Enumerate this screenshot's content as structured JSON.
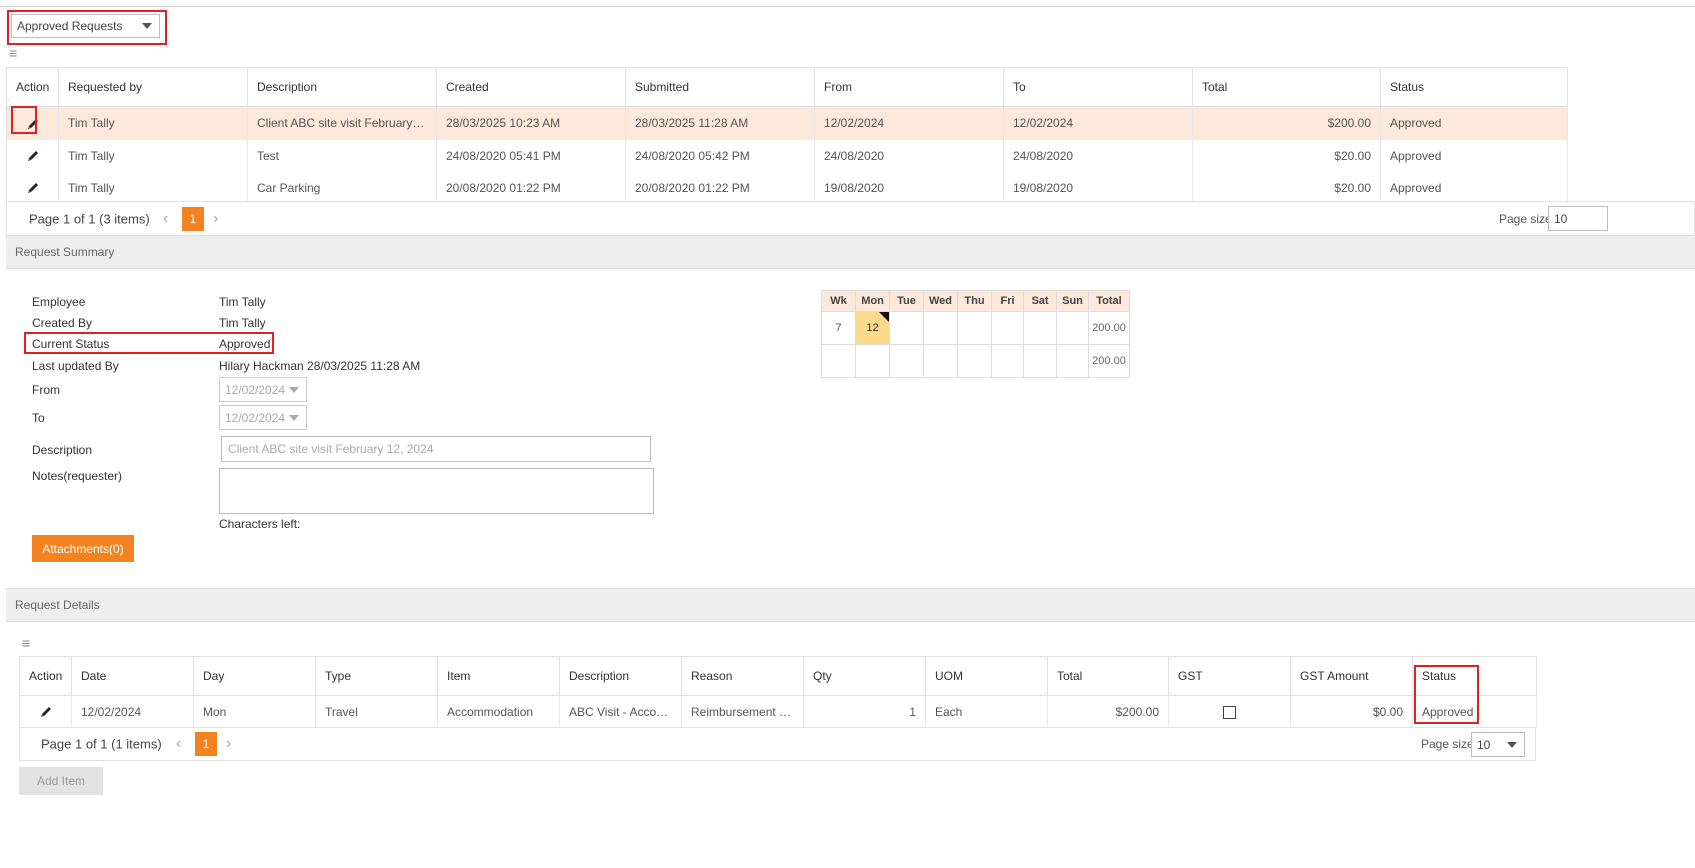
{
  "request_filter": {
    "value": "Approved Requests"
  },
  "requests_grid": {
    "columns": [
      "Action",
      "Requested by",
      "Description",
      "Created",
      "Submitted",
      "From",
      "To",
      "Total",
      "Status"
    ],
    "rows": [
      {
        "requested_by": "Tim Tally",
        "description": "Client ABC site visit February 12, ...",
        "created": "28/03/2025 10:23 AM",
        "submitted": "28/03/2025 11:28 AM",
        "from": "12/02/2024",
        "to": "12/02/2024",
        "total": "$200.00",
        "status": "Approved"
      },
      {
        "requested_by": "Tim Tally",
        "description": "Test",
        "created": "24/08/2020 05:41 PM",
        "submitted": "24/08/2020 05:42 PM",
        "from": "24/08/2020",
        "to": "24/08/2020",
        "total": "$20.00",
        "status": "Approved"
      },
      {
        "requested_by": "Tim Tally",
        "description": "Car Parking",
        "created": "20/08/2020 01:22 PM",
        "submitted": "20/08/2020 01:22 PM",
        "from": "19/08/2020",
        "to": "19/08/2020",
        "total": "$20.00",
        "status": "Approved"
      }
    ],
    "pager": {
      "info": "Page 1 of 1 (3 items)",
      "current_page": "1",
      "page_size_label": "Page size:",
      "page_size": "10"
    }
  },
  "summary": {
    "section_title": "Request Summary",
    "employee_label": "Employee",
    "employee": "Tim Tally",
    "created_by_label": "Created By",
    "created_by": "Tim Tally",
    "status_label": "Current Status",
    "status": "Approved",
    "updated_label": "Last updated By",
    "updated": "Hilary Hackman 28/03/2025 11:28 AM",
    "from_label": "From",
    "from": "12/02/2024",
    "to_label": "To",
    "to": "12/02/2024",
    "description_label": "Description",
    "description": "Client ABC site visit February 12, 2024",
    "notes_label": "Notes(requester)",
    "notes": "",
    "chars_left_label": "Characters left:",
    "attachments_button": "Attachments(0)"
  },
  "calendar": {
    "headers": [
      "Wk",
      "Mon",
      "Tue",
      "Wed",
      "Thu",
      "Fri",
      "Sat",
      "Sun",
      "Total"
    ],
    "row1": {
      "wk": "7",
      "mon": "12",
      "total": "200.00"
    },
    "row2": {
      "total": "200.00"
    }
  },
  "details": {
    "section_title": "Request Details",
    "columns": [
      "Action",
      "Date",
      "Day",
      "Type",
      "Item",
      "Description",
      "Reason",
      "Qty",
      "UOM",
      "Total",
      "GST",
      "GST Amount",
      "Status"
    ],
    "rows": [
      {
        "date": "12/02/2024",
        "day": "Mon",
        "type": "Travel",
        "item": "Accommodation",
        "description": "ABC Visit - Accomm...",
        "reason": "Reimbursement - R...",
        "qty": "1",
        "uom": "Each",
        "total": "$200.00",
        "gst_checked": false,
        "gst_amount": "$0.00",
        "status": "Approved"
      }
    ],
    "pager": {
      "info": "Page 1 of 1 (1 items)",
      "current_page": "1",
      "page_size_label": "Page size:",
      "page_size": "10"
    },
    "add_item_button": "Add Item"
  },
  "icons": {
    "edit": "pencil-icon",
    "menu": "hamburger-menu-icon",
    "prev": "chevron-left-icon",
    "next": "chevron-right-icon"
  },
  "colors": {
    "accent": "#f4821f",
    "selected_row": "#fde9dc",
    "highlight_day": "#fdd98a",
    "callout": "#e32020"
  }
}
